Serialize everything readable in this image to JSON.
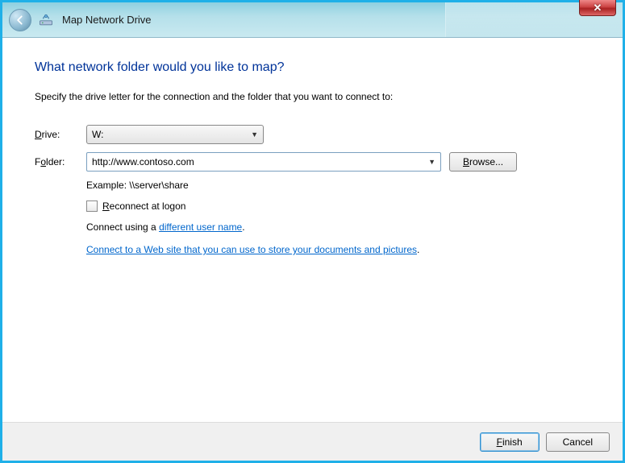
{
  "titlebar": {
    "title": "Map Network Drive"
  },
  "heading": "What network folder would you like to map?",
  "instruction": "Specify the drive letter for the connection and the folder that you want to connect to:",
  "form": {
    "drive_label_pre": "",
    "drive_label_u": "D",
    "drive_label_post": "rive:",
    "drive_value": "W:",
    "folder_label_pre": "F",
    "folder_label_u": "o",
    "folder_label_post": "lder:",
    "folder_value": "http://www.contoso.com",
    "browse_u": "B",
    "browse_post": "rowse...",
    "example": "Example: \\\\server\\share",
    "reconnect_u": "R",
    "reconnect_post": "econnect at logon",
    "connect_prefix": "Connect using a ",
    "connect_link": "different user name",
    "connect_suffix": ".",
    "web_link": "Connect to a Web site that you can use to store your documents and pictures",
    "web_suffix": "."
  },
  "footer": {
    "finish_u": "F",
    "finish_post": "inish",
    "cancel": "Cancel"
  }
}
